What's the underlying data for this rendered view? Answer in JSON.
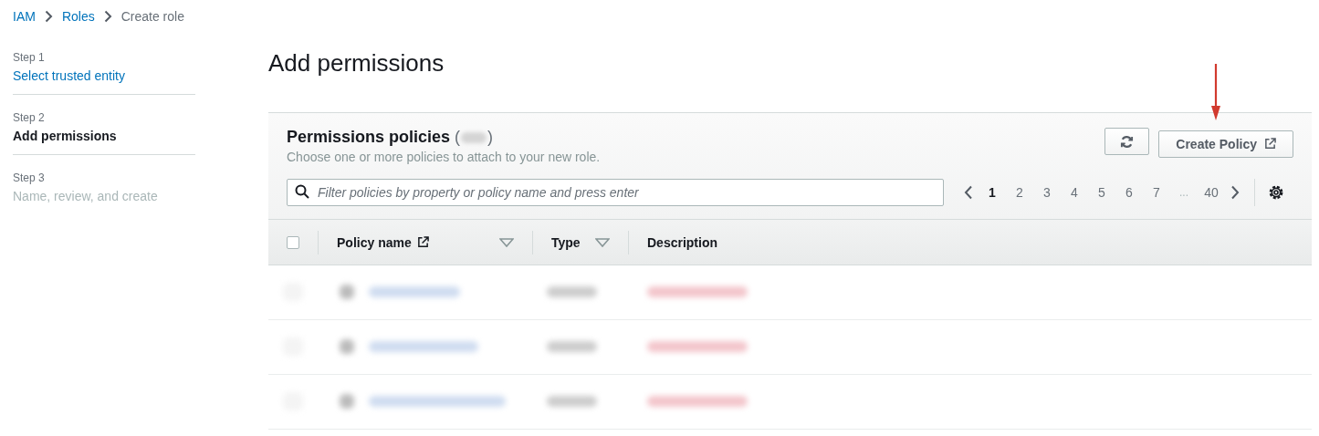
{
  "breadcrumb": [
    {
      "label": "IAM",
      "kind": "link"
    },
    {
      "label": "Roles",
      "kind": "link"
    },
    {
      "label": "Create role",
      "kind": "current"
    }
  ],
  "steps": [
    {
      "step": "Step 1",
      "title": "Select trusted entity",
      "completed": true,
      "selected": false
    },
    {
      "step": "Step 2",
      "title": "Add permissions",
      "completed": false,
      "selected": true
    },
    {
      "step": "Step 3",
      "title": "Name, review, and create",
      "completed": false,
      "selected": false
    }
  ],
  "page_title": "Add permissions",
  "panel": {
    "title": "Permissions policies",
    "count": {
      "open": "(",
      "close": ")",
      "blurred": true
    },
    "select_all": {
      "checked": false
    },
    "subtitle": "Choose one or more policies to attach to your new role.",
    "create_button": "Create Policy",
    "search": {
      "placeholder": "Filter policies by property or policy name and press enter"
    },
    "pagination": [
      {
        "label": "1",
        "selected": true,
        "kind": "page"
      },
      {
        "label": "2",
        "selected": false,
        "kind": "page"
      },
      {
        "label": "3",
        "selected": false,
        "kind": "page"
      },
      {
        "label": "4",
        "selected": false,
        "kind": "page"
      },
      {
        "label": "5",
        "selected": false,
        "kind": "page"
      },
      {
        "label": "6",
        "selected": false,
        "kind": "page"
      },
      {
        "label": "7",
        "selected": false,
        "kind": "page"
      },
      {
        "label": "...",
        "selected": false,
        "kind": "ellipsis"
      },
      {
        "label": "40",
        "selected": false,
        "kind": "page"
      }
    ],
    "columns": [
      {
        "label": "Policy name",
        "external": true,
        "sortable": true
      },
      {
        "label": "Type",
        "external": false,
        "sortable": true
      },
      {
        "label": "Description",
        "external": false,
        "sortable": false
      }
    ],
    "rows": [
      {
        "kind": "blurred"
      },
      {
        "kind": "blurred"
      },
      {
        "kind": "blurred"
      }
    ]
  },
  "annotations": [
    {
      "kind": "arrow"
    }
  ]
}
